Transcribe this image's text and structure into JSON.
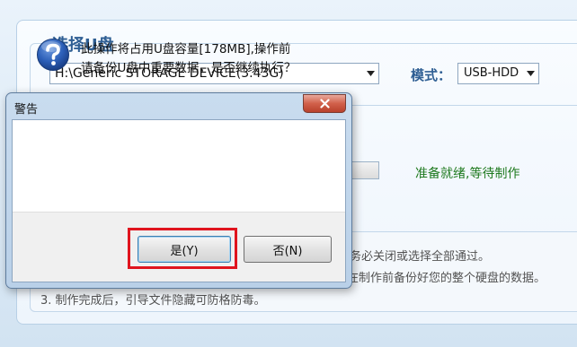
{
  "main": {
    "group_title": "选择U盘",
    "device_value": "H:\\Generic STORAGE DEVICE(3.43G)",
    "mode_label": "模式：",
    "mode_value": "USB-HDD",
    "status_text": "准备就绪,等待制作",
    "notes": [
      "请务必关闭或选择全部通过。",
      "在制作前备份好您的整个硬盘的数据。",
      "3. 制作完成后，引导文件隐藏可防格防毒。"
    ]
  },
  "dialog": {
    "title": "警告",
    "message_line1": "此操作将占用U盘容量[178MB],操作前",
    "message_line2": "请备份U盘中重要数据，是否继续执行？",
    "yes_label": "是(Y)",
    "no_label": "否(N)",
    "icon": "question-icon",
    "highlight_color": "#e0141e"
  },
  "colors": {
    "accent": "#2e5e93",
    "status": "#1f7a1f"
  }
}
